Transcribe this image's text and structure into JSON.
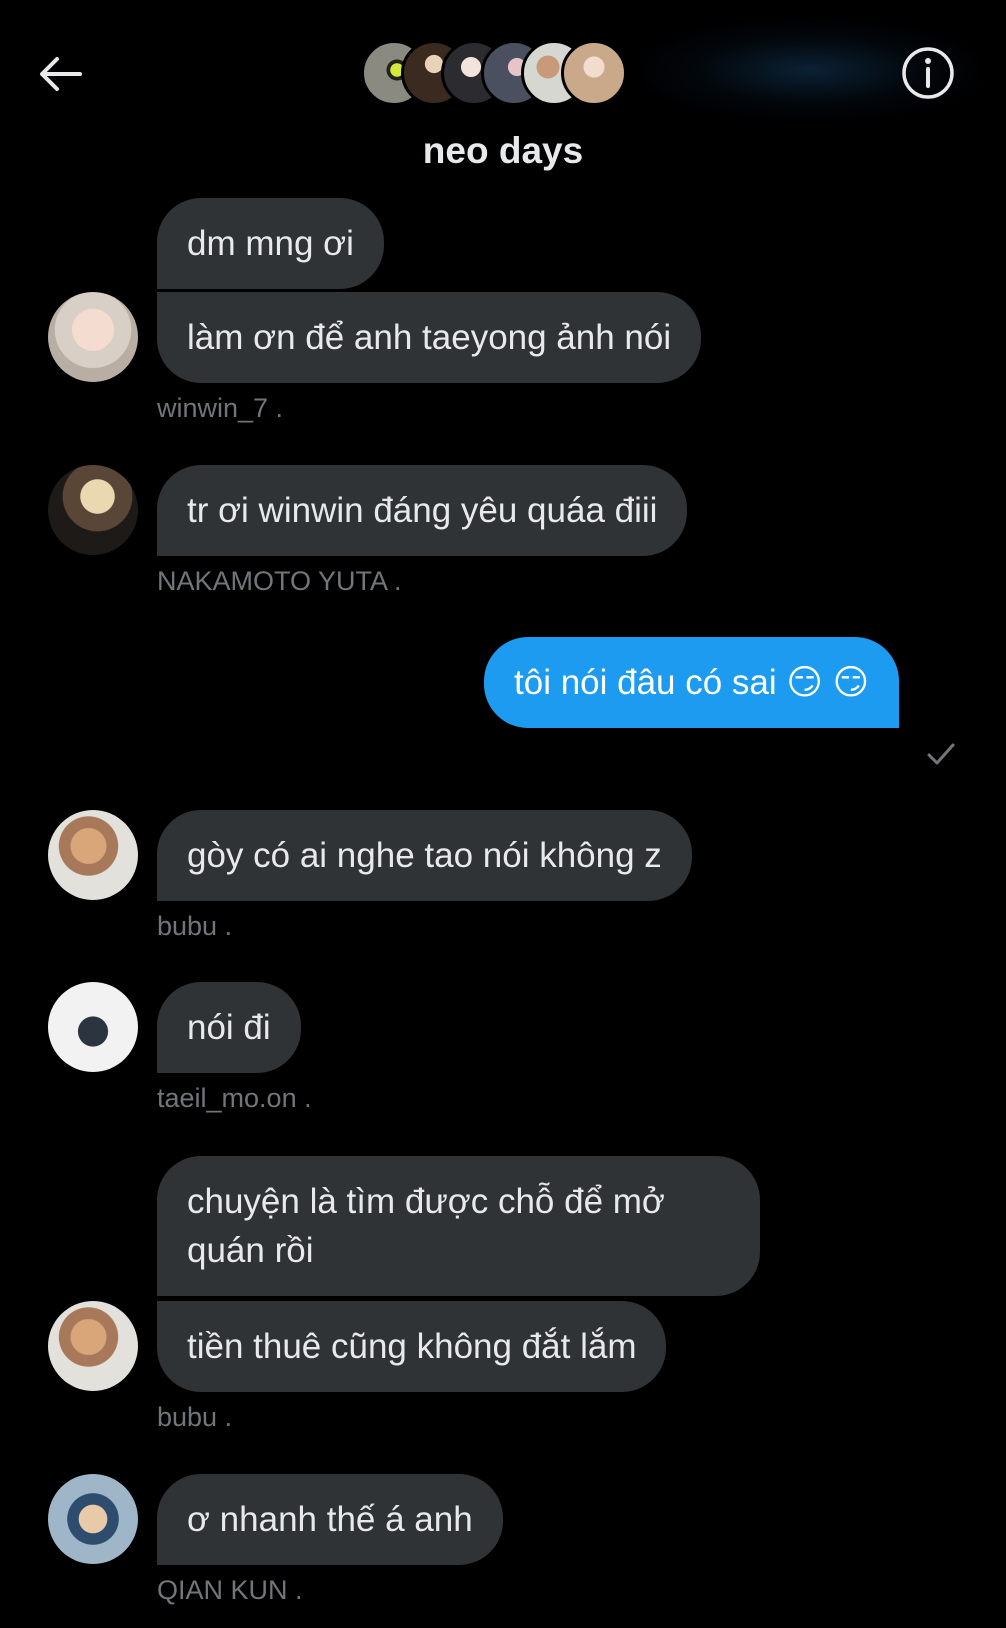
{
  "header": {
    "back_icon": "arrow-left-icon",
    "info_icon": "info-circle-icon",
    "title": "neo days"
  },
  "messages": [
    {
      "text": "dm mng ơi",
      "side": "received"
    },
    {
      "text": "làm ơn để anh taeyong ảnh nói",
      "side": "received"
    },
    {
      "sender": "winwin_7 .",
      "side": "meta"
    },
    {
      "text": "tr ơi winwin đáng yêu quáa điii",
      "side": "received"
    },
    {
      "sender": "NAKAMOTO YUTA .",
      "side": "meta"
    },
    {
      "text": "tôi nói đâu có sai 😏 😏",
      "side": "sent"
    },
    {
      "text": "gòy có ai nghe tao nói không z",
      "side": "received"
    },
    {
      "sender": "bubu .",
      "side": "meta"
    },
    {
      "text": "nói đi",
      "side": "received"
    },
    {
      "sender": "taeil_mo.on .",
      "side": "meta"
    },
    {
      "text": "chuyện là tìm được chỗ để mở quán rồi",
      "side": "received"
    },
    {
      "text": "tiền thuê cũng không đắt lắm",
      "side": "received"
    },
    {
      "sender": "bubu .",
      "side": "meta"
    },
    {
      "text": "ơ nhanh thế á anh",
      "side": "received"
    },
    {
      "sender": "QIAN KUN .",
      "side": "meta"
    }
  ],
  "colors": {
    "background": "#000000",
    "bubble_received": "#2f3336",
    "bubble_sent": "#1d9bf0",
    "text_primary": "#e7e9ea",
    "text_secondary": "#71767b"
  }
}
